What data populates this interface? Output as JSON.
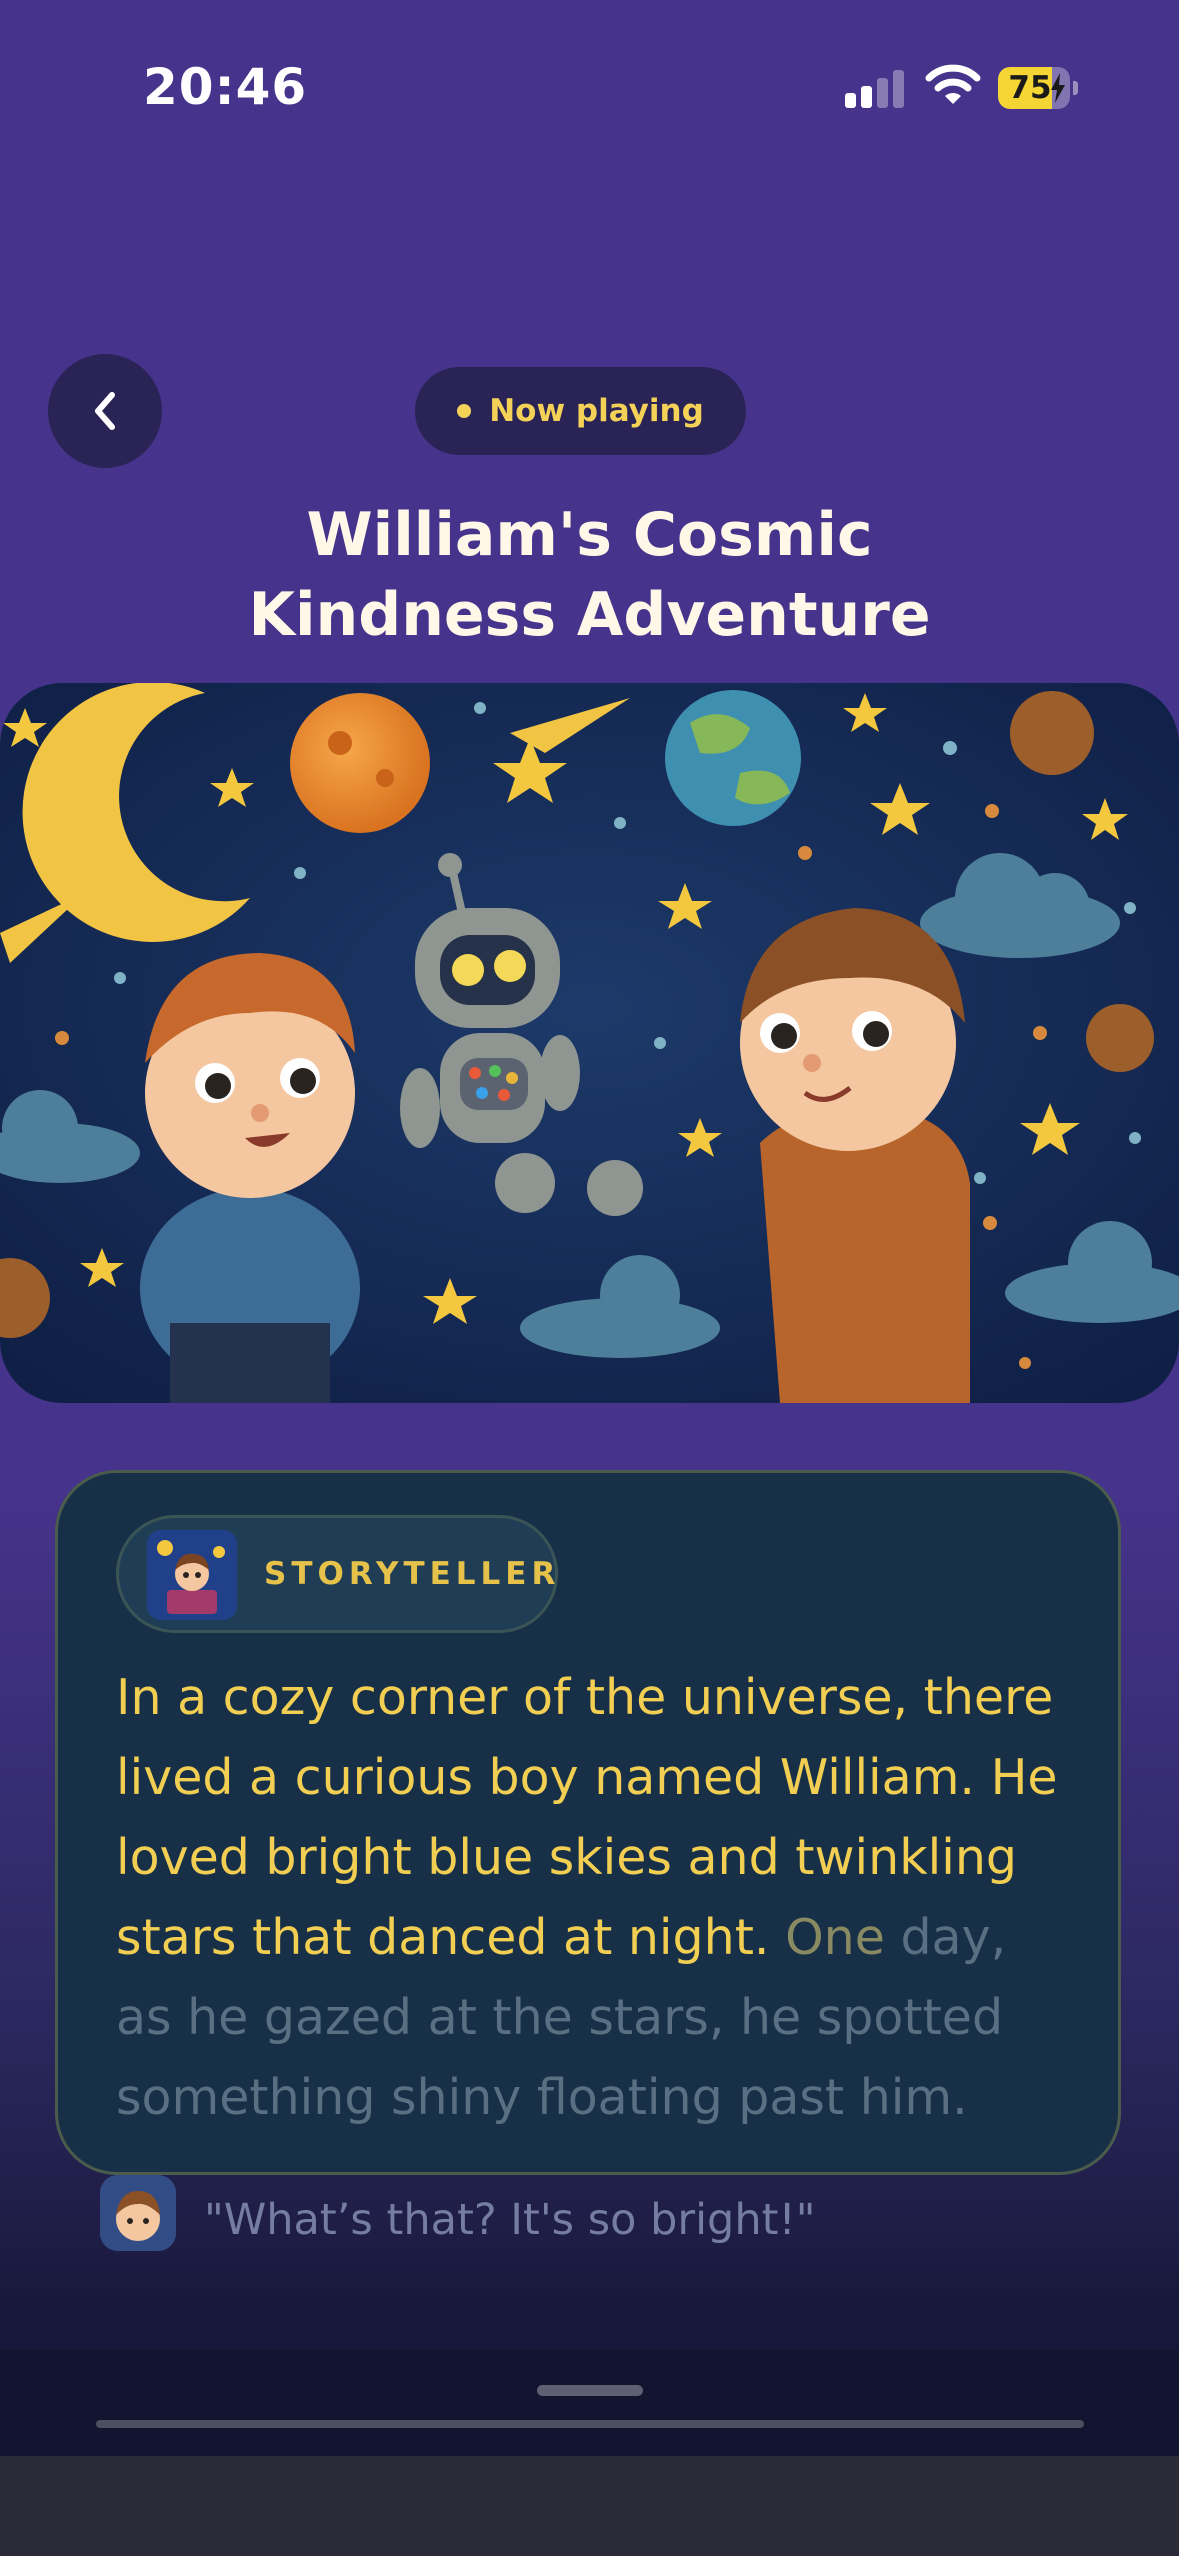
{
  "status_bar": {
    "time": "20:46",
    "battery": "75",
    "battery_level": 0.75
  },
  "header": {
    "now_playing": "Now playing"
  },
  "story": {
    "title_line1": "William's Cosmic",
    "title_line2": "Kindness Adventure",
    "speaker_label": "STORYTELLER",
    "text_read": "In a cozy corner of the universe, there lived a curious boy named William. He loved bright blue skies and twinkling stars that danced at night.",
    "text_current": "One",
    "text_upcoming": "day, as he gazed at the stars, he spotted something shiny floating past him.",
    "next_line": "\"What’s that? It's so bright!\""
  },
  "player": {
    "progress": 0
  },
  "colors": {
    "background": "#46338b",
    "accent": "#f2cf52",
    "card": "#173048"
  },
  "icons": {
    "back": "chevron-left-icon",
    "signal": "cellular-signal-icon",
    "wifi": "wifi-icon",
    "charging": "bolt-icon"
  }
}
